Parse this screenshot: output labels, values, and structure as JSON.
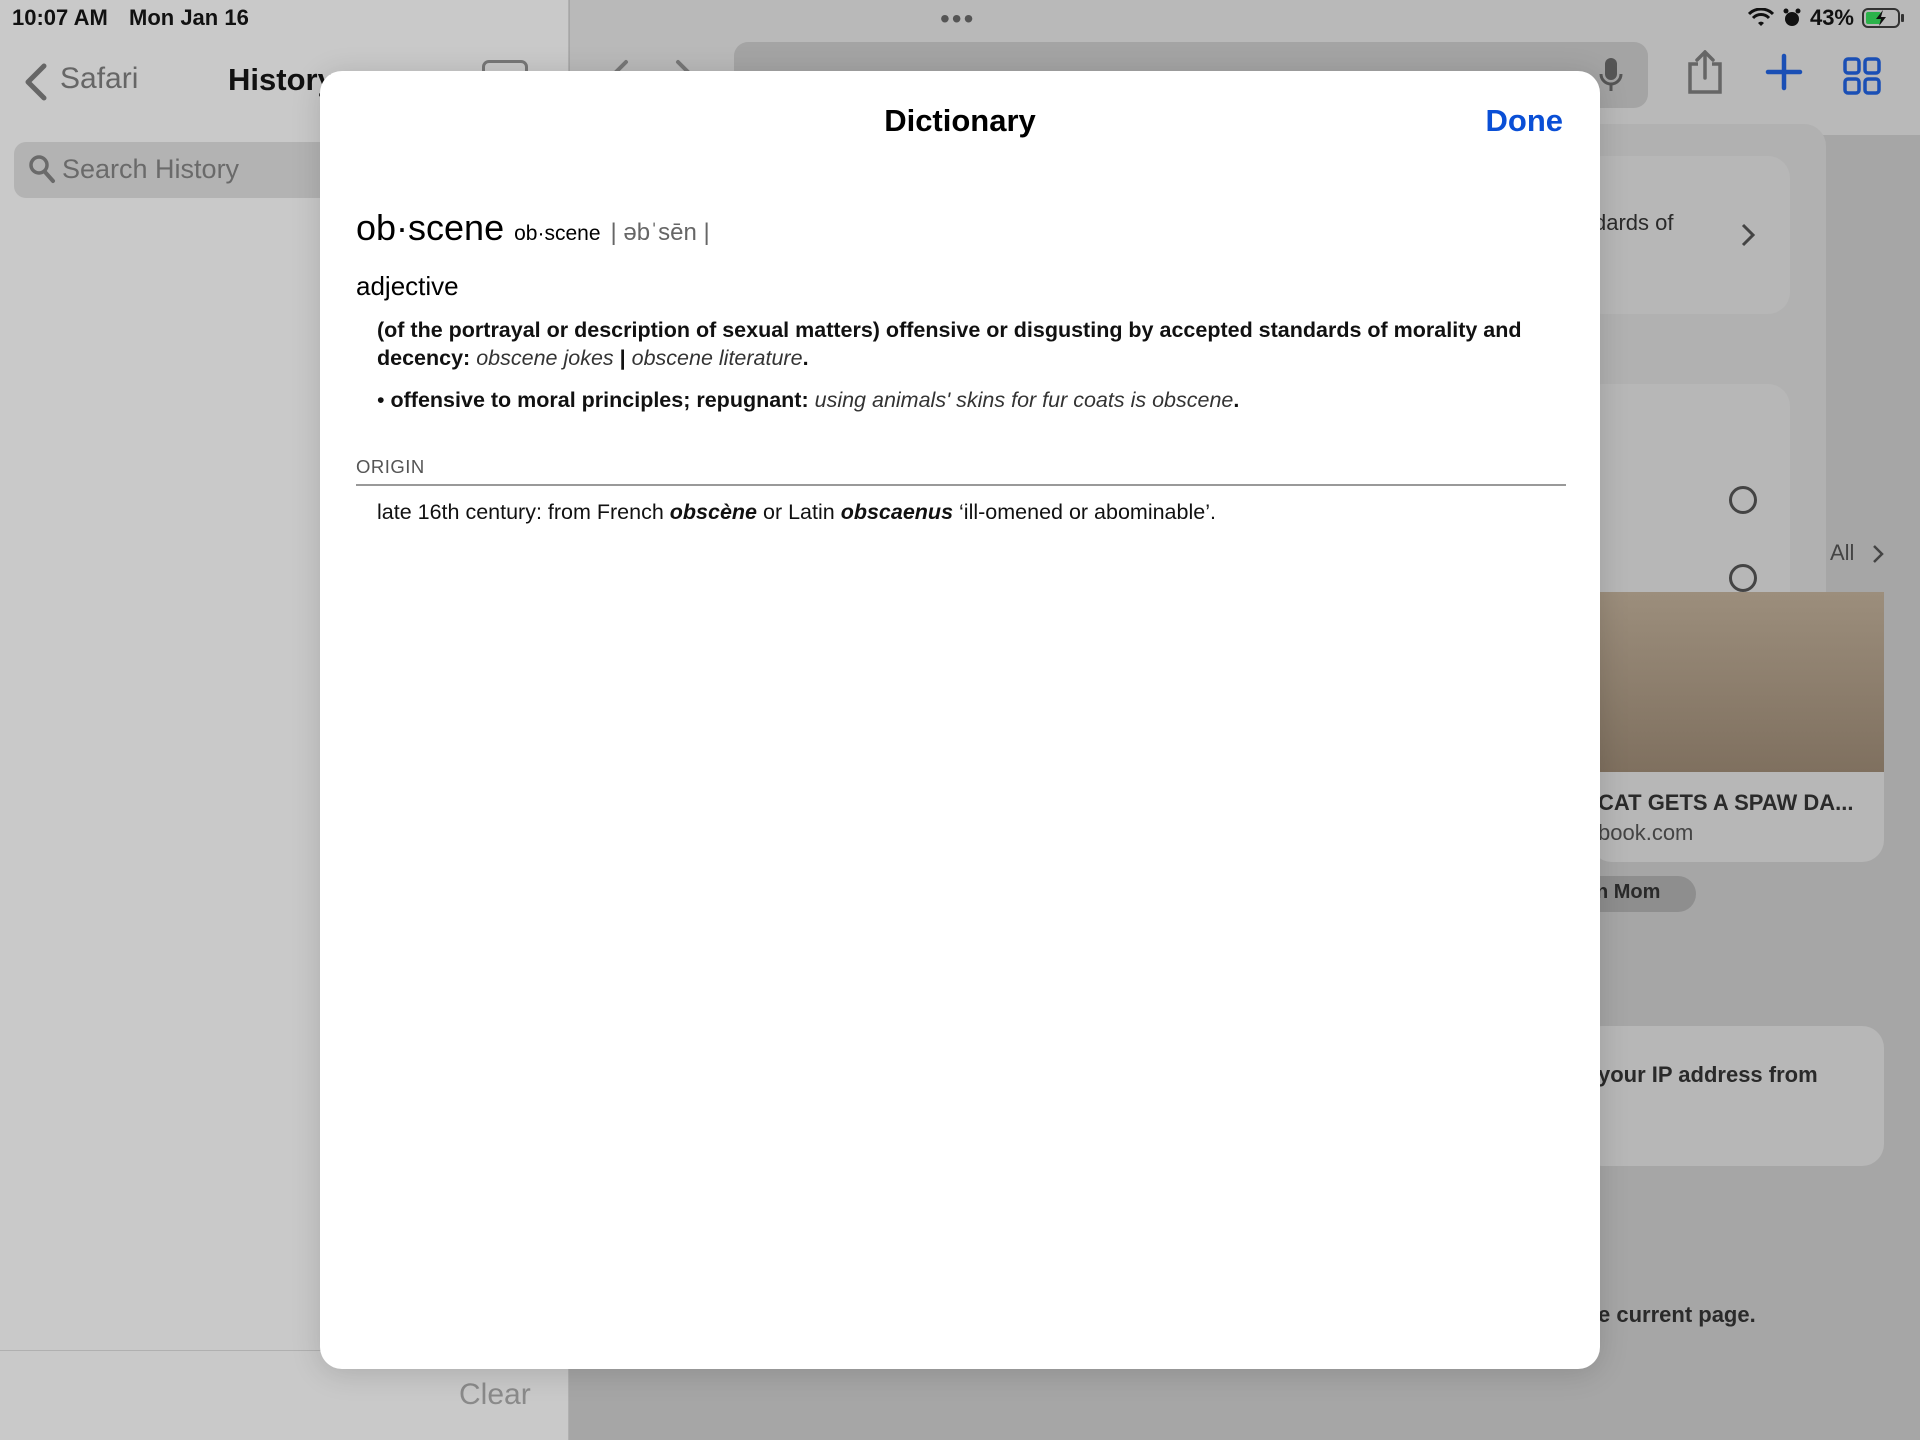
{
  "status_bar": {
    "time": "10:07 AM",
    "date": "Mon Jan 16",
    "battery": "43%"
  },
  "sidebar": {
    "back_label": "Safari",
    "title": "History",
    "search_placeholder": "Search History",
    "clear_label": "Clear"
  },
  "browser": {
    "card1_text": "dards of",
    "see_all": "All",
    "story_title": "CAT GETS A SPAW DA...",
    "story_domain": "book.com",
    "pill_label": "n Mom",
    "privacy_text": "your IP address from",
    "footer_text": "e current page."
  },
  "dictionary": {
    "title": "Dictionary",
    "done_label": "Done",
    "headword": "ob·scene",
    "syllables": "ob·scene",
    "pronunciation": "| əbˈsēn |",
    "part_of_speech": "adjective",
    "definition": "(of the portrayal or description of sexual matters) offensive or disgusting by accepted standards of morality and decency:",
    "example_1": "obscene jokes",
    "example_separator": "|",
    "example_2": "obscene literature",
    "sub_definition": "offensive to moral principles; repugnant:",
    "sub_example": "using animals' skins for fur coats is obscene",
    "origin_heading": "ORIGIN",
    "origin_prefix": "late 16th century: from French",
    "origin_word_1": "obscène",
    "origin_mid": "or Latin",
    "origin_word_2": "obscaenus",
    "origin_suffix": "‘ill-omened or abominable’."
  }
}
